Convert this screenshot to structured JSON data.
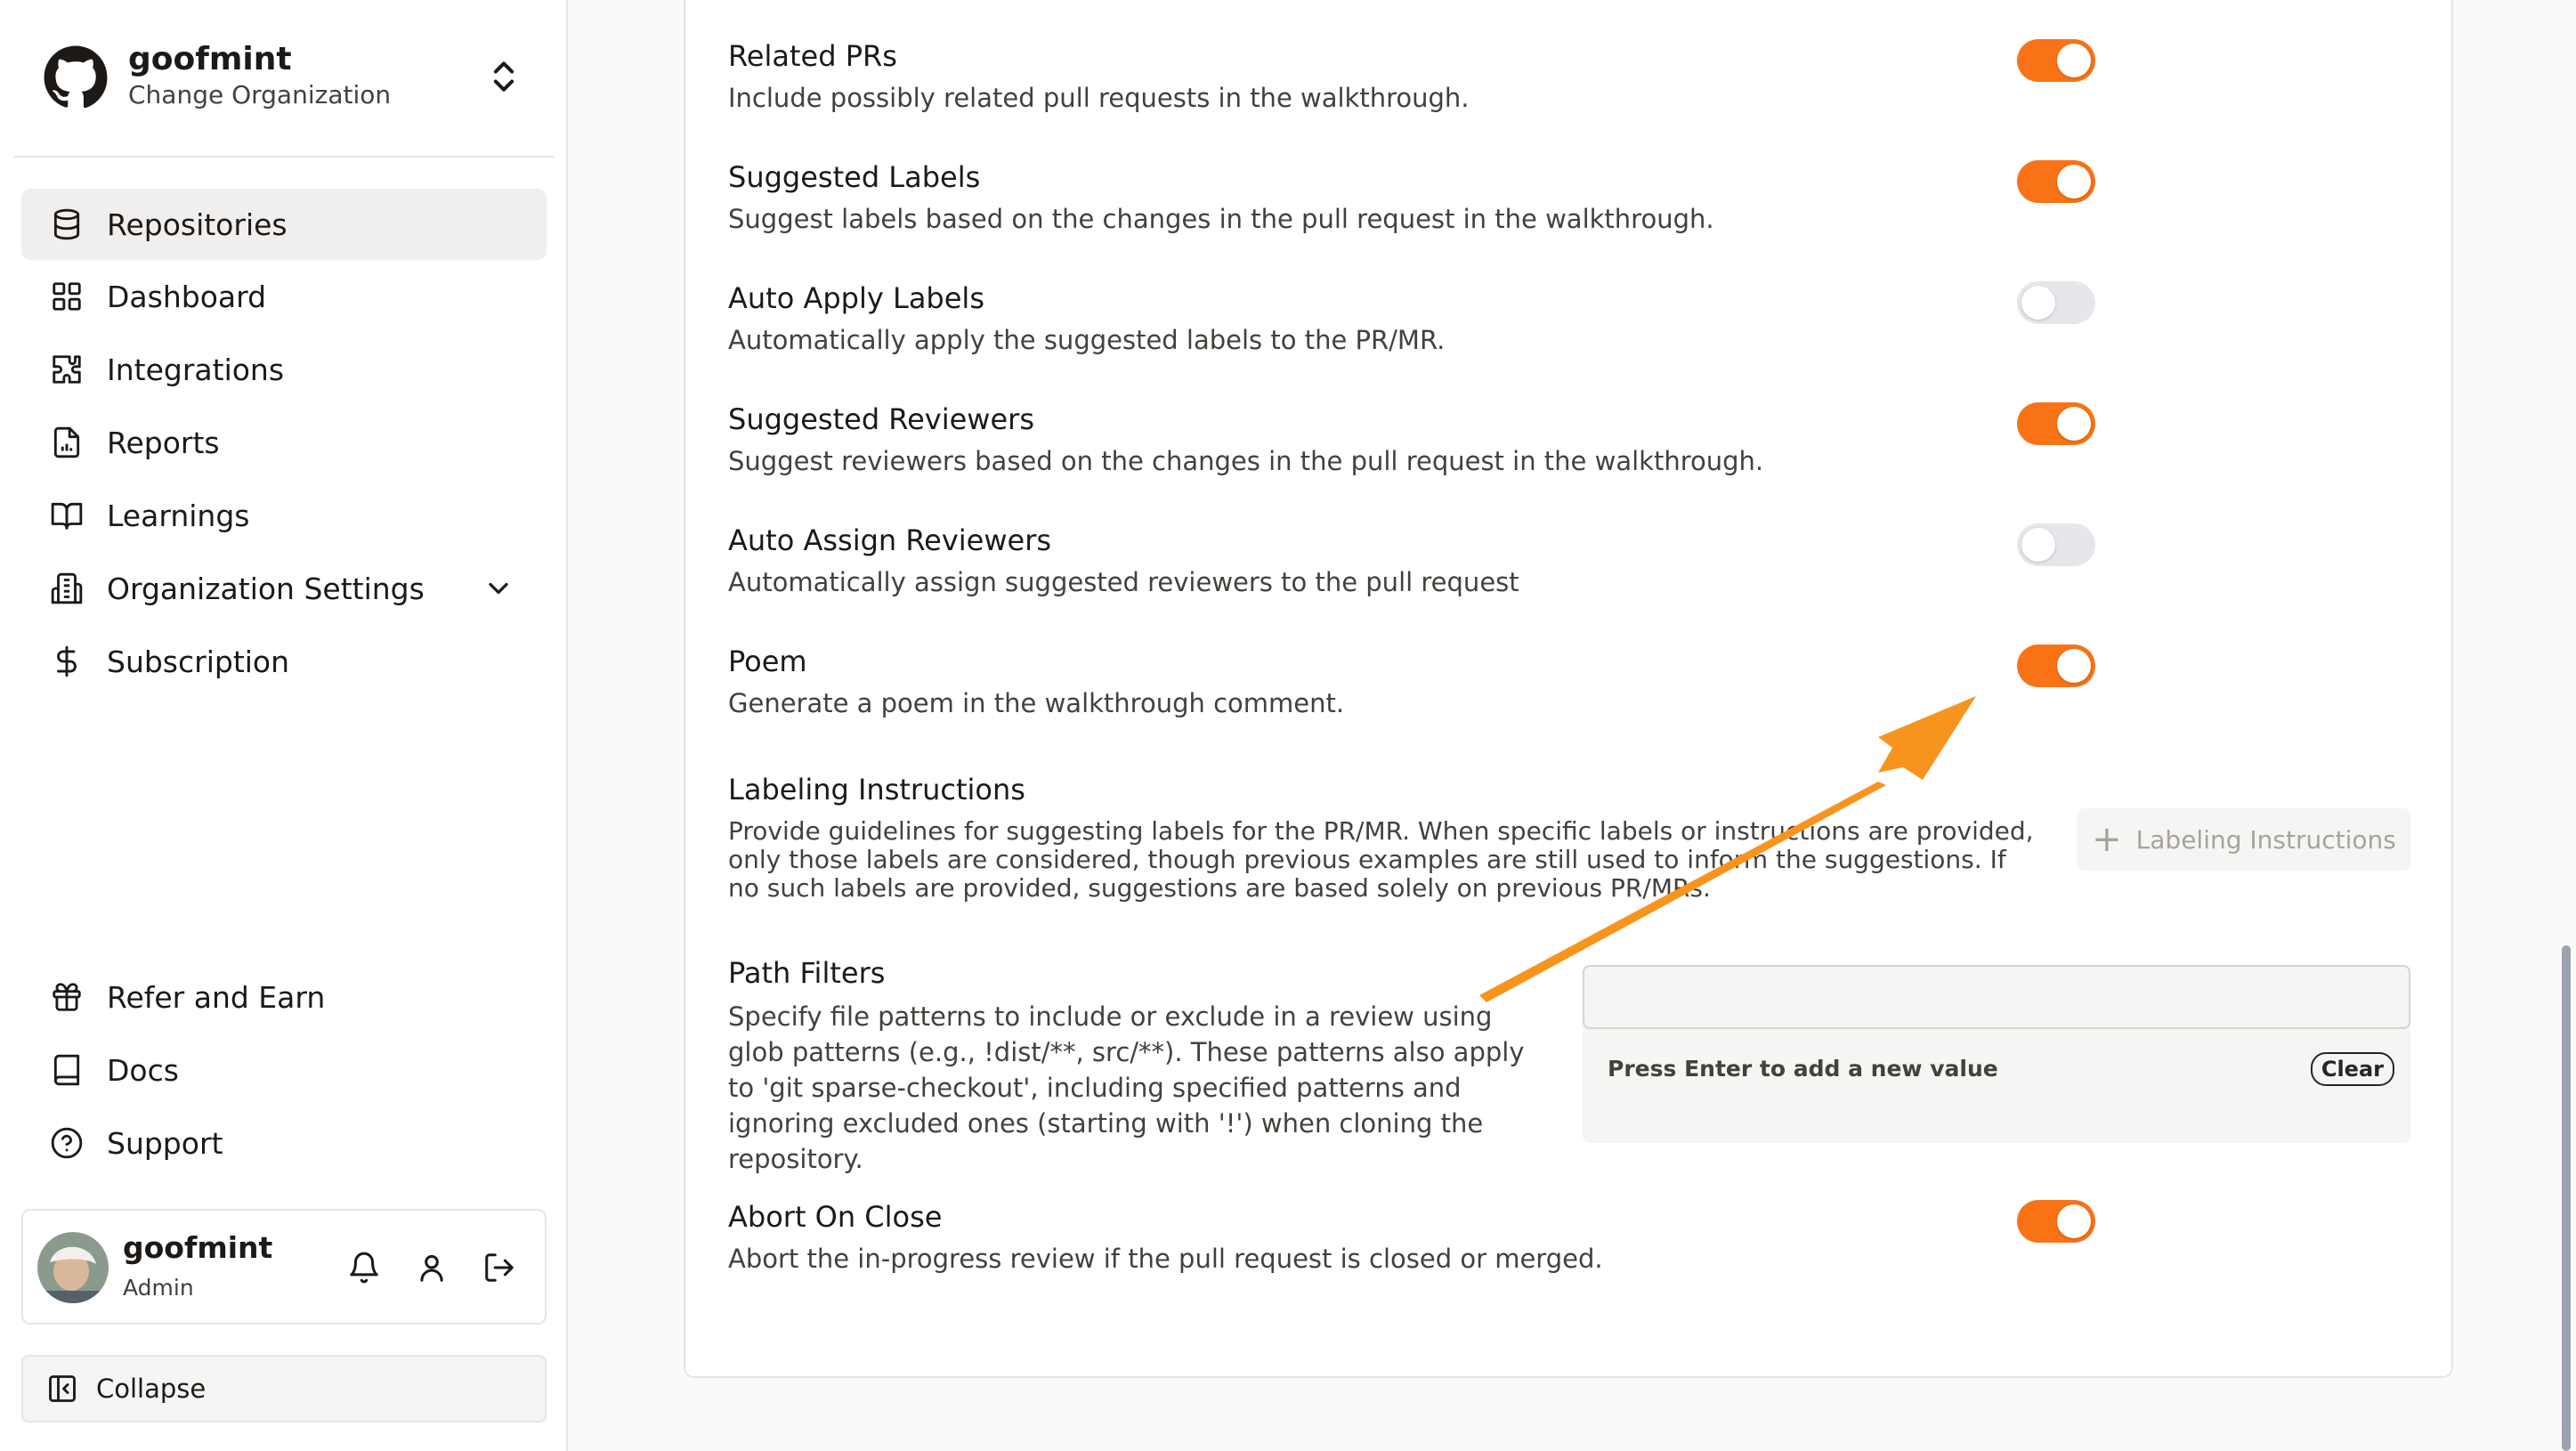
{
  "org": {
    "name": "goofmint",
    "subtitle": "Change Organization"
  },
  "nav": {
    "items": [
      {
        "label": "Repositories",
        "icon": "database-icon"
      },
      {
        "label": "Dashboard",
        "icon": "grid-icon"
      },
      {
        "label": "Integrations",
        "icon": "puzzle-icon"
      },
      {
        "label": "Reports",
        "icon": "report-icon"
      },
      {
        "label": "Learnings",
        "icon": "book-open-icon"
      },
      {
        "label": "Organization Settings",
        "icon": "building-icon"
      },
      {
        "label": "Subscription",
        "icon": "dollar-icon"
      }
    ],
    "bottom": [
      {
        "label": "Refer and Earn",
        "icon": "gift-icon"
      },
      {
        "label": "Docs",
        "icon": "book-icon"
      },
      {
        "label": "Support",
        "icon": "help-icon"
      }
    ]
  },
  "user": {
    "name": "goofmint",
    "role": "Admin"
  },
  "collapse_label": "Collapse",
  "settings": [
    {
      "title": "Related PRs",
      "desc": "Include possibly related pull requests in the walkthrough.",
      "enabled": true
    },
    {
      "title": "Suggested Labels",
      "desc": "Suggest labels based on the changes in the pull request in the walkthrough.",
      "enabled": true
    },
    {
      "title": "Auto Apply Labels",
      "desc": "Automatically apply the suggested labels to the PR/MR.",
      "enabled": false
    },
    {
      "title": "Suggested Reviewers",
      "desc": "Suggest reviewers based on the changes in the pull request in the walkthrough.",
      "enabled": true
    },
    {
      "title": "Auto Assign Reviewers",
      "desc": "Automatically assign suggested reviewers to the pull request",
      "enabled": false
    },
    {
      "title": "Poem",
      "desc": "Generate a poem in the walkthrough comment.",
      "enabled": true
    }
  ],
  "labeling": {
    "title": "Labeling Instructions",
    "desc": "Provide guidelines for suggesting labels for the PR/MR. When specific labels or instructions are provided, only those labels are considered, though previous examples are still used to inform the suggestions. If no such labels are provided, suggestions are based solely on previous PR/MRs.",
    "button_label": "Labeling Instructions"
  },
  "path_filters": {
    "title": "Path Filters",
    "desc": "Specify file patterns to include or exclude in a review using glob patterns (e.g., !dist/**, src/**). These patterns also apply to 'git sparse-checkout', including specified patterns and ignoring excluded ones (starting with '!') when cloning the repository.",
    "input_value": "",
    "hint": "Press Enter to add a new value",
    "clear_label": "Clear"
  },
  "abort_on_close": {
    "title": "Abort On Close",
    "desc": "Abort the in-progress review if the pull request is closed or merged.",
    "enabled": true
  },
  "colors": {
    "accent": "#f97316",
    "toggle_off": "#e5e7eb",
    "arrow": "#f7941d"
  }
}
